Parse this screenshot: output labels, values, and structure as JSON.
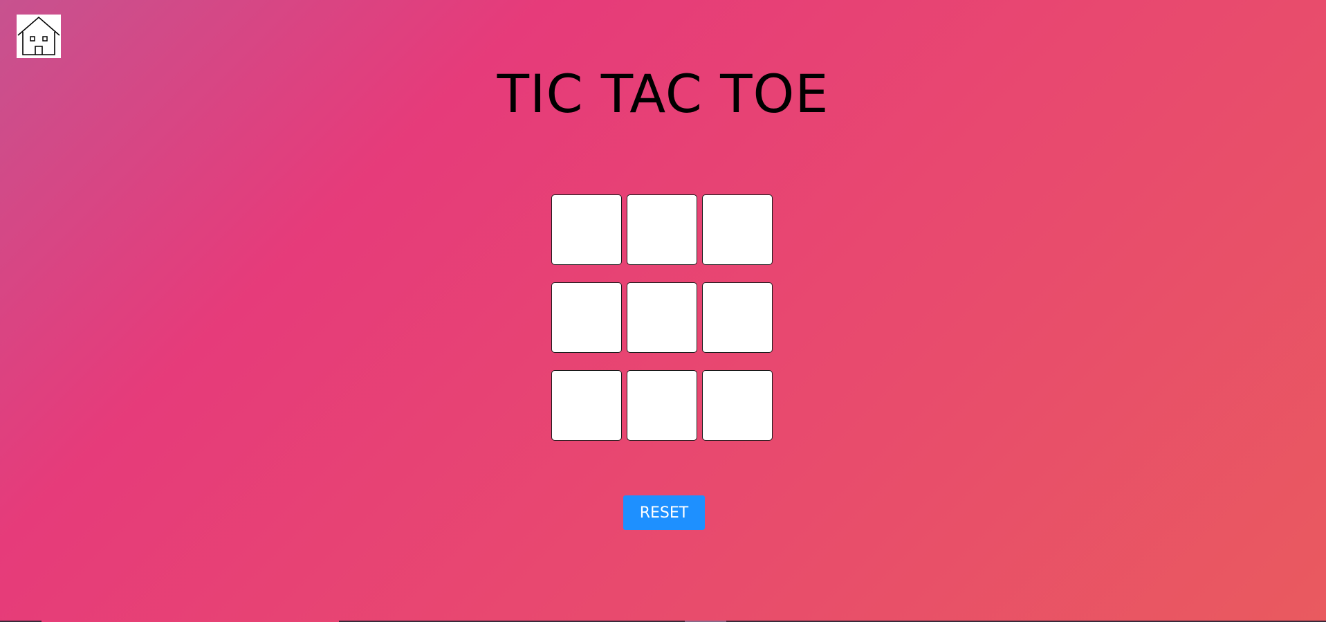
{
  "header": {
    "home_icon": "home-icon"
  },
  "game": {
    "title": "TIC TAC TOE",
    "board": [
      [
        "",
        "",
        ""
      ],
      [
        "",
        "",
        ""
      ],
      [
        "",
        "",
        ""
      ]
    ]
  },
  "controls": {
    "reset_label": "RESET"
  },
  "colors": {
    "background_start": "#c7528f",
    "background_mid": "#e63b7a",
    "background_end": "#e95a5f",
    "reset_button": "#1e90ff",
    "cell": "#ffffff"
  }
}
